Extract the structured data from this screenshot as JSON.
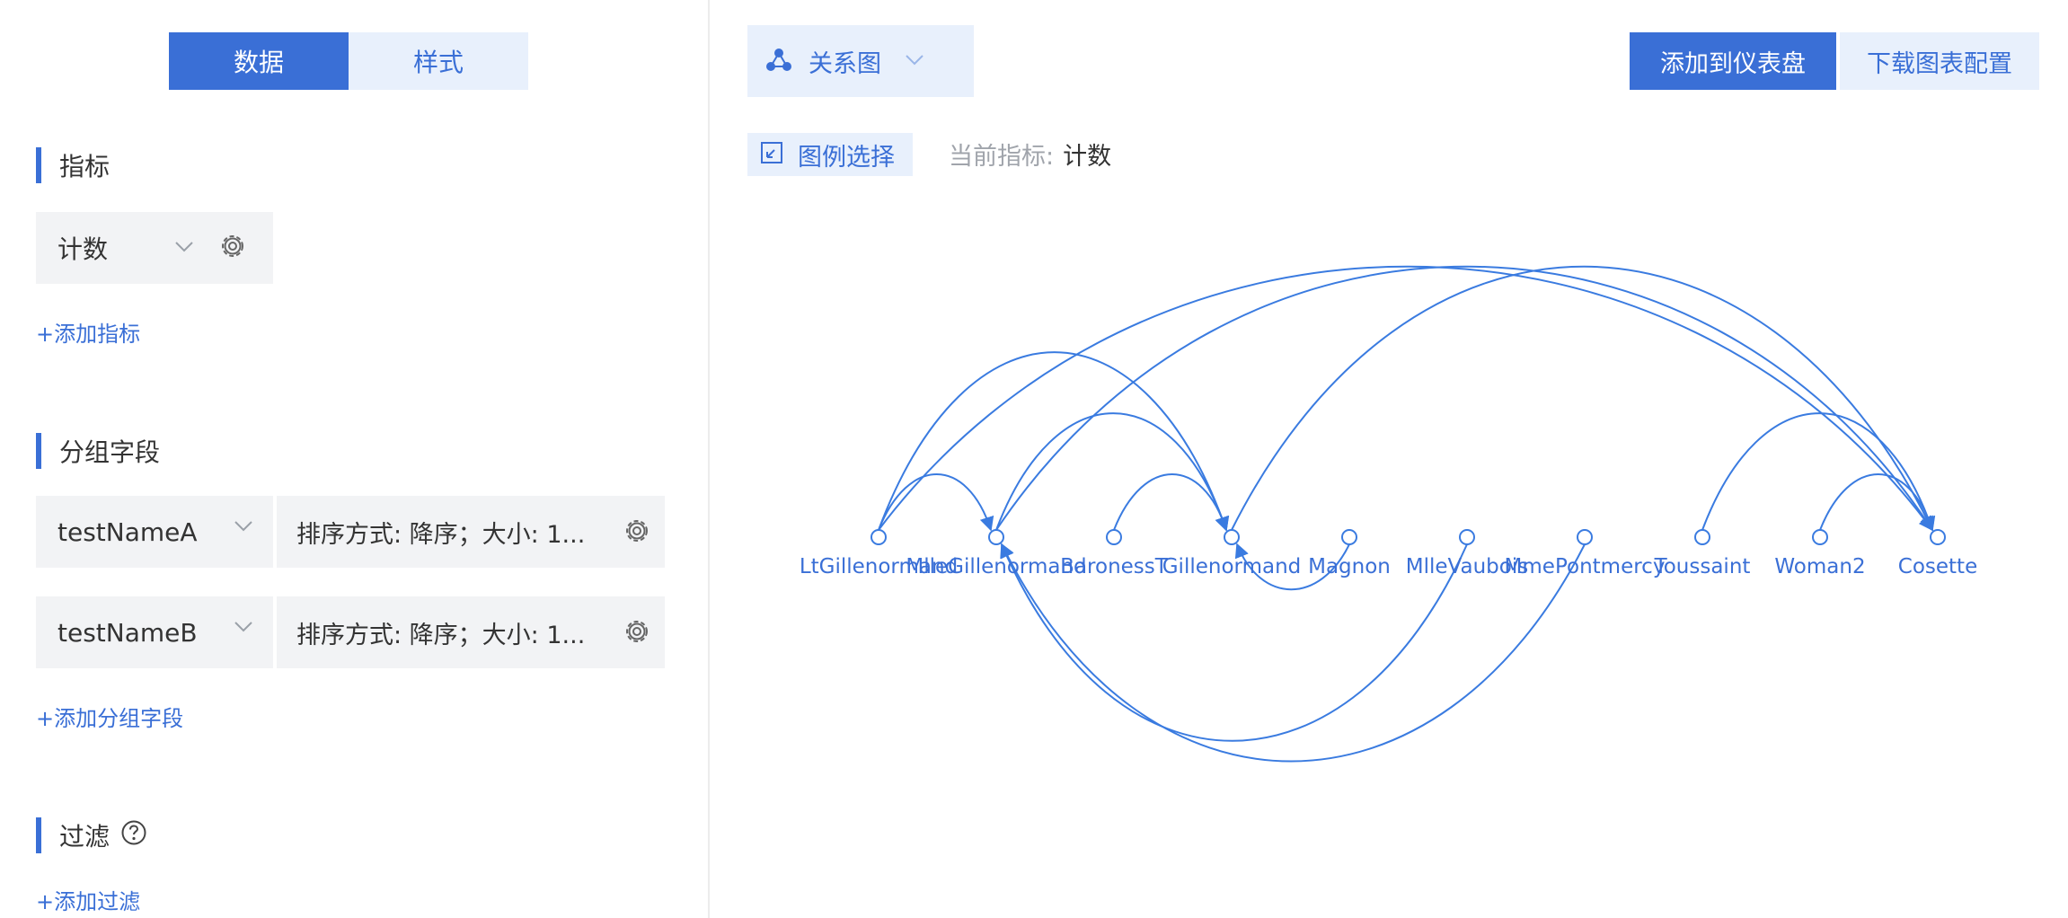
{
  "sidebar": {
    "tabs": [
      {
        "label": "数据",
        "active": true
      },
      {
        "label": "样式",
        "active": false
      }
    ],
    "metrics": {
      "title": "指标",
      "items": [
        {
          "label": "计数"
        }
      ],
      "add_label": "+添加指标"
    },
    "groups": {
      "title": "分组字段",
      "items": [
        {
          "field": "testNameA",
          "sort": "排序方式: 降序；大小: 1..."
        },
        {
          "field": "testNameB",
          "sort": "排序方式: 降序；大小: 1..."
        }
      ],
      "add_label": "+添加分组字段"
    },
    "filter": {
      "title": "过滤",
      "add_label": "+添加过滤"
    }
  },
  "header": {
    "chart_type": {
      "label": "关系图",
      "icon": "relation-graph-icon"
    },
    "add_to_dashboard": "添加到仪表盘",
    "download_config": "下载图表配置",
    "legend_select": "图例选择",
    "current_metric_label": "当前指标:",
    "current_metric_value": "计数"
  },
  "colors": {
    "accent": "#3a6fd6",
    "accent_light": "#e8f0fc",
    "field_bg": "#f2f3f5",
    "muted_text": "#a0a4ab",
    "edge": "#3a7be0"
  },
  "chart_data": {
    "type": "graph",
    "nodes": [
      "LtGillenormand",
      "MlleGillenormand",
      "BaronessT",
      "Gillenormand",
      "Magnon",
      "MlleVaubois",
      "MmePontmercy",
      "Toussaint",
      "Woman2",
      "Cosette"
    ],
    "edges": [
      {
        "source": "LtGillenormand",
        "target": "MlleGillenormand"
      },
      {
        "source": "LtGillenormand",
        "target": "Gillenormand"
      },
      {
        "source": "LtGillenormand",
        "target": "Cosette"
      },
      {
        "source": "MlleGillenormand",
        "target": "Gillenormand"
      },
      {
        "source": "MlleGillenormand",
        "target": "Cosette"
      },
      {
        "source": "BaronessT",
        "target": "Gillenormand"
      },
      {
        "source": "Gillenormand",
        "target": "Cosette"
      },
      {
        "source": "Magnon",
        "target": "Gillenormand"
      },
      {
        "source": "MlleVaubois",
        "target": "MlleGillenormand"
      },
      {
        "source": "MmePontmercy",
        "target": "MlleGillenormand"
      },
      {
        "source": "Toussaint",
        "target": "Cosette"
      },
      {
        "source": "Woman2",
        "target": "Cosette"
      }
    ]
  }
}
